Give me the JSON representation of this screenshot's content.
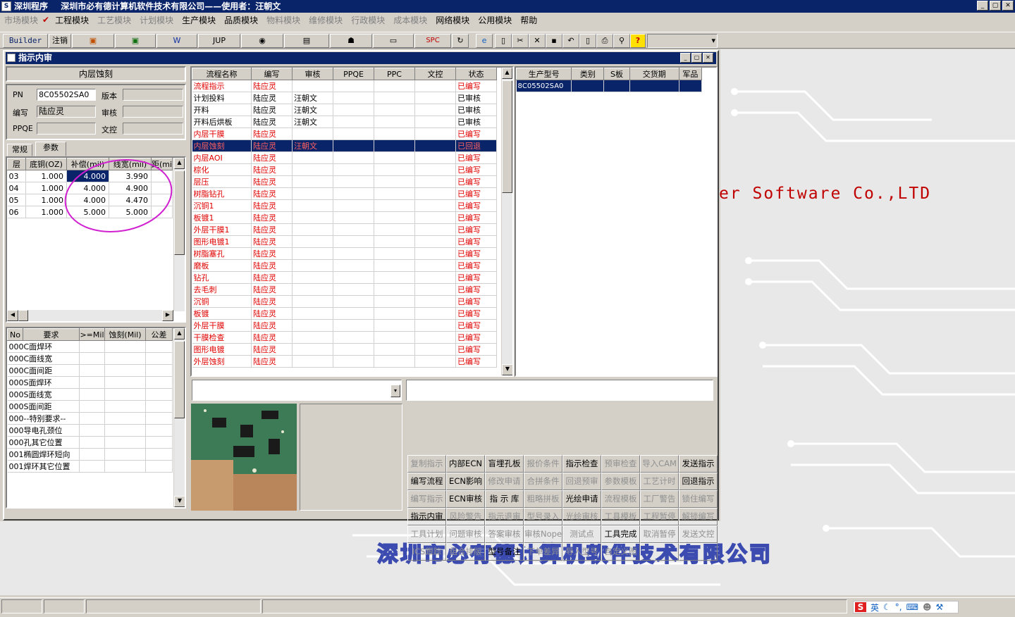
{
  "app": {
    "title": "深圳程序",
    "company": "深圳市必有德计算机软件技术有限公司——使用者：汪朝文"
  },
  "menu": [
    {
      "label": "市场模块",
      "disabled": true
    },
    {
      "label": "工程模块",
      "disabled": false,
      "checked": true
    },
    {
      "label": "工艺模块",
      "disabled": true
    },
    {
      "label": "计划模块",
      "disabled": true
    },
    {
      "label": "生产模块",
      "disabled": false
    },
    {
      "label": "品质模块",
      "disabled": false
    },
    {
      "label": "物料模块",
      "disabled": true
    },
    {
      "label": "维修模块",
      "disabled": true
    },
    {
      "label": "行政模块",
      "disabled": true
    },
    {
      "label": "成本模块",
      "disabled": true
    },
    {
      "label": "网络模块",
      "disabled": false
    },
    {
      "label": "公用模块",
      "disabled": false
    },
    {
      "label": "帮助",
      "disabled": false
    }
  ],
  "toolbar": {
    "builder": "Builder",
    "logout": "注销",
    "jup": "JUP",
    "spc": "SPC"
  },
  "child": {
    "title": "指示内审"
  },
  "left": {
    "header": "内层蚀刻",
    "pn_label": "PN",
    "pn_value": "8C05502SA0",
    "version_label": "版本",
    "version_value": "",
    "writer_label": "编写",
    "writer_value": "陆应灵",
    "review_label": "审核",
    "review_value": "",
    "ppqe_label": "PPQE",
    "ppqe_value": "",
    "doc_label": "文控",
    "doc_value": "",
    "tabs": [
      "常规",
      "参数"
    ],
    "param_headers": [
      "层",
      "底铜(OZ)",
      "补偿(mil)",
      "线宽(mil)",
      "距(mi"
    ],
    "params": [
      [
        "03",
        "1.000",
        "4.000",
        "3.990"
      ],
      [
        "04",
        "1.000",
        "4.000",
        "4.900"
      ],
      [
        "05",
        "1.000",
        "4.000",
        "4.470"
      ],
      [
        "06",
        "1.000",
        "5.000",
        "5.000"
      ]
    ],
    "req_headers": [
      "No",
      "要求",
      ">=Mil",
      "蚀刻(Mil)",
      "公差"
    ],
    "reqs": [
      [
        "000",
        "C面焊环"
      ],
      [
        "000",
        "C面线宽"
      ],
      [
        "000",
        "C面间距"
      ],
      [
        "000",
        "S面焊环"
      ],
      [
        "000",
        "S面线宽"
      ],
      [
        "000",
        "S面间距"
      ],
      [
        "000",
        "--特别要求--"
      ],
      [
        "000",
        "导电孔颈位"
      ],
      [
        "000",
        "孔其它位置"
      ],
      [
        "001",
        "椭圆焊环短向"
      ],
      [
        "001",
        "焊环其它位置"
      ]
    ]
  },
  "flow": {
    "headers": [
      "流程名称",
      "编写",
      "审核",
      "PPQE",
      "PPC",
      "文控",
      "状态"
    ],
    "rows": [
      {
        "name": "流程指示",
        "writer": "陆应灵",
        "reviewer": "",
        "status": "已编写",
        "red": true
      },
      {
        "name": "计划投料",
        "writer": "陆应灵",
        "reviewer": "汪朝文",
        "status": "已审核",
        "red": false
      },
      {
        "name": "开料",
        "writer": "陆应灵",
        "reviewer": "汪朝文",
        "status": "已审核",
        "red": false
      },
      {
        "name": "开料后烘板",
        "writer": "陆应灵",
        "reviewer": "汪朝文",
        "status": "已审核",
        "red": false
      },
      {
        "name": "内层干膜",
        "writer": "陆应灵",
        "reviewer": "",
        "status": "已编写",
        "red": true
      },
      {
        "name": "内层蚀刻",
        "writer": "陆应灵",
        "reviewer": "汪朝文",
        "status": "已回退",
        "red": true,
        "selected": true
      },
      {
        "name": "内层AOI",
        "writer": "陆应灵",
        "reviewer": "",
        "status": "已编写",
        "red": true
      },
      {
        "name": "棕化",
        "writer": "陆应灵",
        "reviewer": "",
        "status": "已编写",
        "red": true
      },
      {
        "name": "层压",
        "writer": "陆应灵",
        "reviewer": "",
        "status": "已编写",
        "red": true
      },
      {
        "name": "树脂钻孔",
        "writer": "陆应灵",
        "reviewer": "",
        "status": "已编写",
        "red": true
      },
      {
        "name": "沉铜1",
        "writer": "陆应灵",
        "reviewer": "",
        "status": "已编写",
        "red": true
      },
      {
        "name": "板镀1",
        "writer": "陆应灵",
        "reviewer": "",
        "status": "已编写",
        "red": true
      },
      {
        "name": "外层干膜1",
        "writer": "陆应灵",
        "reviewer": "",
        "status": "已编写",
        "red": true
      },
      {
        "name": "图形电镀1",
        "writer": "陆应灵",
        "reviewer": "",
        "status": "已编写",
        "red": true
      },
      {
        "name": "树脂塞孔",
        "writer": "陆应灵",
        "reviewer": "",
        "status": "已编写",
        "red": true
      },
      {
        "name": "磨板",
        "writer": "陆应灵",
        "reviewer": "",
        "status": "已编写",
        "red": true
      },
      {
        "name": "钻孔",
        "writer": "陆应灵",
        "reviewer": "",
        "status": "已编写",
        "red": true
      },
      {
        "name": "去毛刺",
        "writer": "陆应灵",
        "reviewer": "",
        "status": "已编写",
        "red": true
      },
      {
        "name": "沉铜",
        "writer": "陆应灵",
        "reviewer": "",
        "status": "已编写",
        "red": true
      },
      {
        "name": "板镀",
        "writer": "陆应灵",
        "reviewer": "",
        "status": "已编写",
        "red": true
      },
      {
        "name": "外层干膜",
        "writer": "陆应灵",
        "reviewer": "",
        "status": "已编写",
        "red": true
      },
      {
        "name": "干膜检查",
        "writer": "陆应灵",
        "reviewer": "",
        "status": "已编写",
        "red": true
      },
      {
        "name": "图形电镀",
        "writer": "陆应灵",
        "reviewer": "",
        "status": "已编写",
        "red": true
      },
      {
        "name": "外层蚀刻",
        "writer": "陆应灵",
        "reviewer": "",
        "status": "已编写",
        "red": true
      }
    ]
  },
  "product": {
    "headers": [
      "生产型号",
      "类别",
      "S板",
      "交货期",
      "军品"
    ],
    "rows": [
      [
        "8C05502SA0",
        "",
        "",
        "",
        ""
      ]
    ]
  },
  "buttons": [
    [
      "复制指示",
      "内部ECN",
      "盲埋孔板",
      "报价条件",
      "指示检查",
      "预审检查",
      "导入CAM",
      "发送指示"
    ],
    [
      "编写流程",
      "ECN影响",
      "修改申请",
      "合拼条件",
      "回退预审",
      "参数模板",
      "工艺计时",
      "回退指示"
    ],
    [
      "编写指示",
      "ECN审核",
      "指 示 库",
      "粗略拼板",
      "光绘申请",
      "流程模板",
      "工厂警告",
      "锁住编写"
    ],
    [
      "指示内审",
      "风险警告",
      "指示退审",
      "型号录入",
      "光绘审核",
      "工具模板",
      "工程暂停",
      "解锁编写"
    ],
    [
      "工具计划",
      "问题审核",
      "答案审核",
      "审核Nope",
      "测试点",
      "工具完成",
      "取消暂停",
      "发送文控"
    ],
    [
      "ICS跟踪",
      "组合排版",
      "型号备注",
      "下单差异",
      "导入型号",
      "自定义图",
      "",
      ""
    ]
  ],
  "disabled_buttons": [
    [
      true,
      false,
      false,
      true,
      false,
      true,
      true,
      false
    ],
    [
      false,
      false,
      true,
      true,
      true,
      true,
      true,
      false
    ],
    [
      true,
      false,
      false,
      true,
      false,
      true,
      true,
      true
    ],
    [
      false,
      true,
      true,
      true,
      true,
      true,
      true,
      true
    ],
    [
      true,
      true,
      true,
      true,
      true,
      false,
      true,
      true
    ],
    [
      true,
      true,
      false,
      true,
      true,
      true,
      true,
      true
    ]
  ],
  "background": {
    "slogan": "er Software Co.,LTD",
    "company_logo": "深圳市必有德计算机软件技术有限公司"
  },
  "tray": {
    "ime": "英"
  }
}
